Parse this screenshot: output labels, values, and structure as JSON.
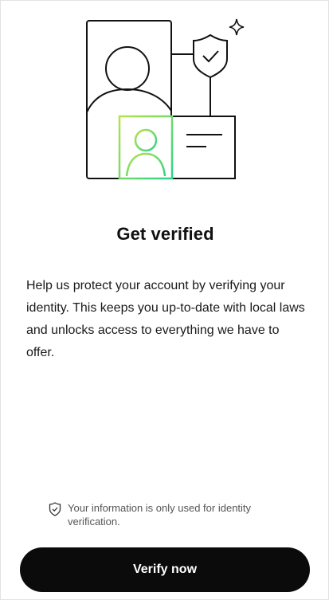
{
  "header": {
    "title": "Get verified"
  },
  "main": {
    "description": "Help us protect your account by verifying your identity. This keeps you up-to-date with local laws and unlocks access to everything we have to offer."
  },
  "footer": {
    "privacy_note": "Your information is only used for identity verification.",
    "verify_button_label": "Verify now"
  },
  "icons": {
    "illustration": "id-verification-illustration",
    "privacy": "shield-check-icon"
  },
  "colors": {
    "accent_gradient_start": "#9be15d",
    "accent_gradient_end": "#00c896",
    "button_bg": "#0b0b0b",
    "button_text": "#ffffff"
  }
}
